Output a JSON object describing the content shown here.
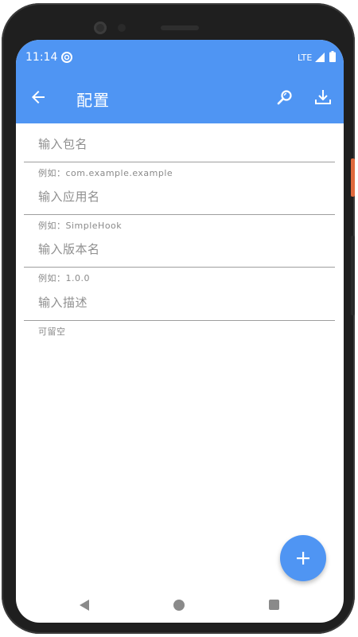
{
  "status_bar": {
    "time": "11:14",
    "network": "LTE"
  },
  "app_bar": {
    "title": "配置",
    "back_icon": "arrow-back-icon",
    "search_icon": "search-icon",
    "download_icon": "download-icon"
  },
  "form": {
    "fields": [
      {
        "placeholder": "输入包名",
        "value": "",
        "helper": "例如：com.example.example"
      },
      {
        "placeholder": "输入应用名",
        "value": "",
        "helper": "例如：SimpleHook"
      },
      {
        "placeholder": "输入版本名",
        "value": "",
        "helper": "例如：1.0.0"
      },
      {
        "placeholder": "输入描述",
        "value": "",
        "helper": "可留空"
      }
    ]
  },
  "fab": {
    "icon": "plus-icon"
  },
  "colors": {
    "primary": "#4f95f3",
    "hint_text": "#8f8f8f",
    "divider": "#9e9e9e"
  }
}
